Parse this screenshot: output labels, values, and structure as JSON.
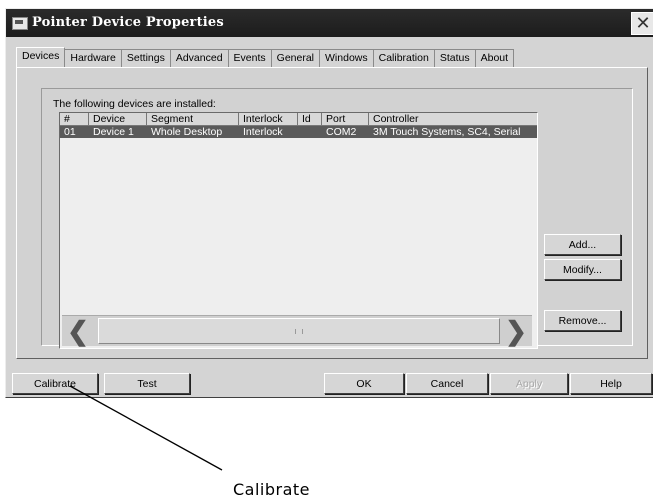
{
  "window": {
    "title": "Pointer Device Properties",
    "close_glyph": "✕"
  },
  "tabs": [
    {
      "label": "Devices",
      "active": true
    },
    {
      "label": "Hardware"
    },
    {
      "label": "Settings"
    },
    {
      "label": "Advanced"
    },
    {
      "label": "Events"
    },
    {
      "label": "General"
    },
    {
      "label": "Windows"
    },
    {
      "label": "Calibration"
    },
    {
      "label": "Status"
    },
    {
      "label": "About"
    }
  ],
  "devices": {
    "group_label": "The following devices are installed:",
    "columns": [
      "#",
      "Device",
      "Segment",
      "Interlock",
      "Id",
      "Port",
      "Controller"
    ],
    "rows": [
      {
        "num": "01",
        "device": "Device 1",
        "segment": "Whole Desktop",
        "interlock": "Interlock",
        "id": "",
        "port": "COM2",
        "controller": "3M Touch Systems, SC4, Serial"
      }
    ],
    "scroll_left_glyph": "❮",
    "scroll_right_glyph": "❯"
  },
  "side_buttons": {
    "add": "Add...",
    "modify": "Modify...",
    "remove": "Remove..."
  },
  "bottom_buttons": {
    "calibrate": "Calibrate",
    "test": "Test",
    "ok": "OK",
    "cancel": "Cancel",
    "apply": "Apply",
    "help": "Help"
  },
  "annotation": {
    "callout_label": "Calibrate"
  }
}
